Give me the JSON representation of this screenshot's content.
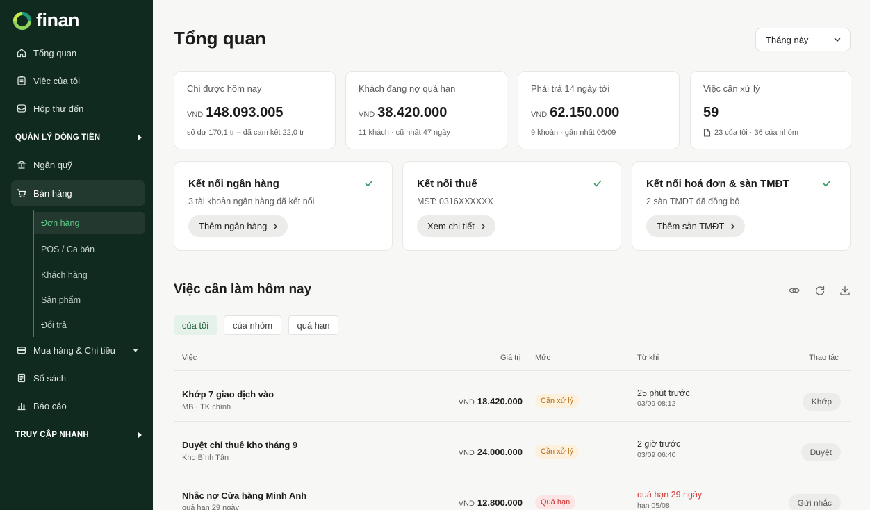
{
  "brand": {
    "name": "finan"
  },
  "sidebar": {
    "items": [
      {
        "label": "Tổng quan",
        "icon": "home-icon"
      },
      {
        "label": "Việc của tôi",
        "icon": "clipboard-icon"
      },
      {
        "label": "Hộp thư đến",
        "icon": "inbox-icon"
      }
    ],
    "section_cashflow": "QUẢN LÝ DÒNG TIỀN",
    "treasury": {
      "label": "Ngân quỹ",
      "icon": "bank-icon"
    },
    "sales": {
      "label": "Bán hàng",
      "icon": "cart-icon"
    },
    "sales_sub": [
      "Đơn hàng",
      "POS / Ca bán",
      "Khách hàng",
      "Sản phẩm",
      "Đổi trả"
    ],
    "purchase": {
      "label": "Mua hàng & Chi tiêu",
      "icon": "wallet-icon"
    },
    "books": {
      "label": "Sổ sách",
      "icon": "book-icon"
    },
    "reports": {
      "label": "Báo cáo",
      "icon": "chart-icon"
    },
    "section_quick": "TRUY CẬP NHANH"
  },
  "header": {
    "title": "Tổng quan",
    "period": "Tháng này"
  },
  "stats": [
    {
      "label": "Chi được hôm nay",
      "currency": "VND",
      "value": "148.093.005",
      "sub": "số dư 170,1 tr – đã cam kết 22,0 tr"
    },
    {
      "label": "Khách đang nợ quá hạn",
      "currency": "VND",
      "value": "38.420.000",
      "sub": "11 khách · cũ nhất 47 ngày"
    },
    {
      "label": "Phải trả 14 ngày tới",
      "currency": "VND",
      "value": "62.150.000",
      "sub": "9 khoản · gần nhất 06/09"
    },
    {
      "label": "Việc cần xử lý",
      "value": "59",
      "sub": "23 của tôi · 36 của nhóm"
    }
  ],
  "connections": [
    {
      "title": "Kết nối ngân hàng",
      "desc": "3 tài khoản ngân hàng đã kết nối",
      "button": "Thêm ngân hàng"
    },
    {
      "title": "Kết nối thuế",
      "desc": "MST: 0316XXXXXX",
      "button": "Xem chi tiết"
    },
    {
      "title": "Kết nối hoá đơn & sàn TMĐT",
      "desc": "2 sàn TMĐT đã đồng bộ",
      "button": "Thêm sàn TMĐT"
    }
  ],
  "accent_color": "#2f9a5c",
  "tasks": {
    "title": "Việc cần làm hôm nay",
    "filters": [
      "của tôi",
      "của nhóm",
      "quá hạn"
    ],
    "columns": {
      "task": "Việc",
      "value": "Giá trị",
      "level": "Mức",
      "since": "Từ khi",
      "action": "Thao tác"
    },
    "rows": [
      {
        "title": "Khớp 7 giao dịch vào",
        "sub": "MB · TK chính",
        "currency": "VND",
        "value": "18.420.000",
        "level": "Cần xử lý",
        "since": "25 phút trước",
        "since_sub": "03/09 08:12",
        "action": "Khớp"
      },
      {
        "title": "Duyệt chi thuê kho tháng 9",
        "sub": "Kho Bình Tân",
        "currency": "VND",
        "value": "24.000.000",
        "level": "Cần xử lý",
        "since": "2 giờ trước",
        "since_sub": "03/09 06:40",
        "action": "Duyệt"
      },
      {
        "title": "Nhắc nợ Cửa hàng Minh Anh",
        "sub": "quá hạn 29 ngày",
        "currency": "VND",
        "value": "12.800.000",
        "level": "Quá hạn",
        "since": "quá hạn 29 ngày",
        "since_sub": "hạn 05/08",
        "action": "Gửi nhắc"
      }
    ]
  }
}
